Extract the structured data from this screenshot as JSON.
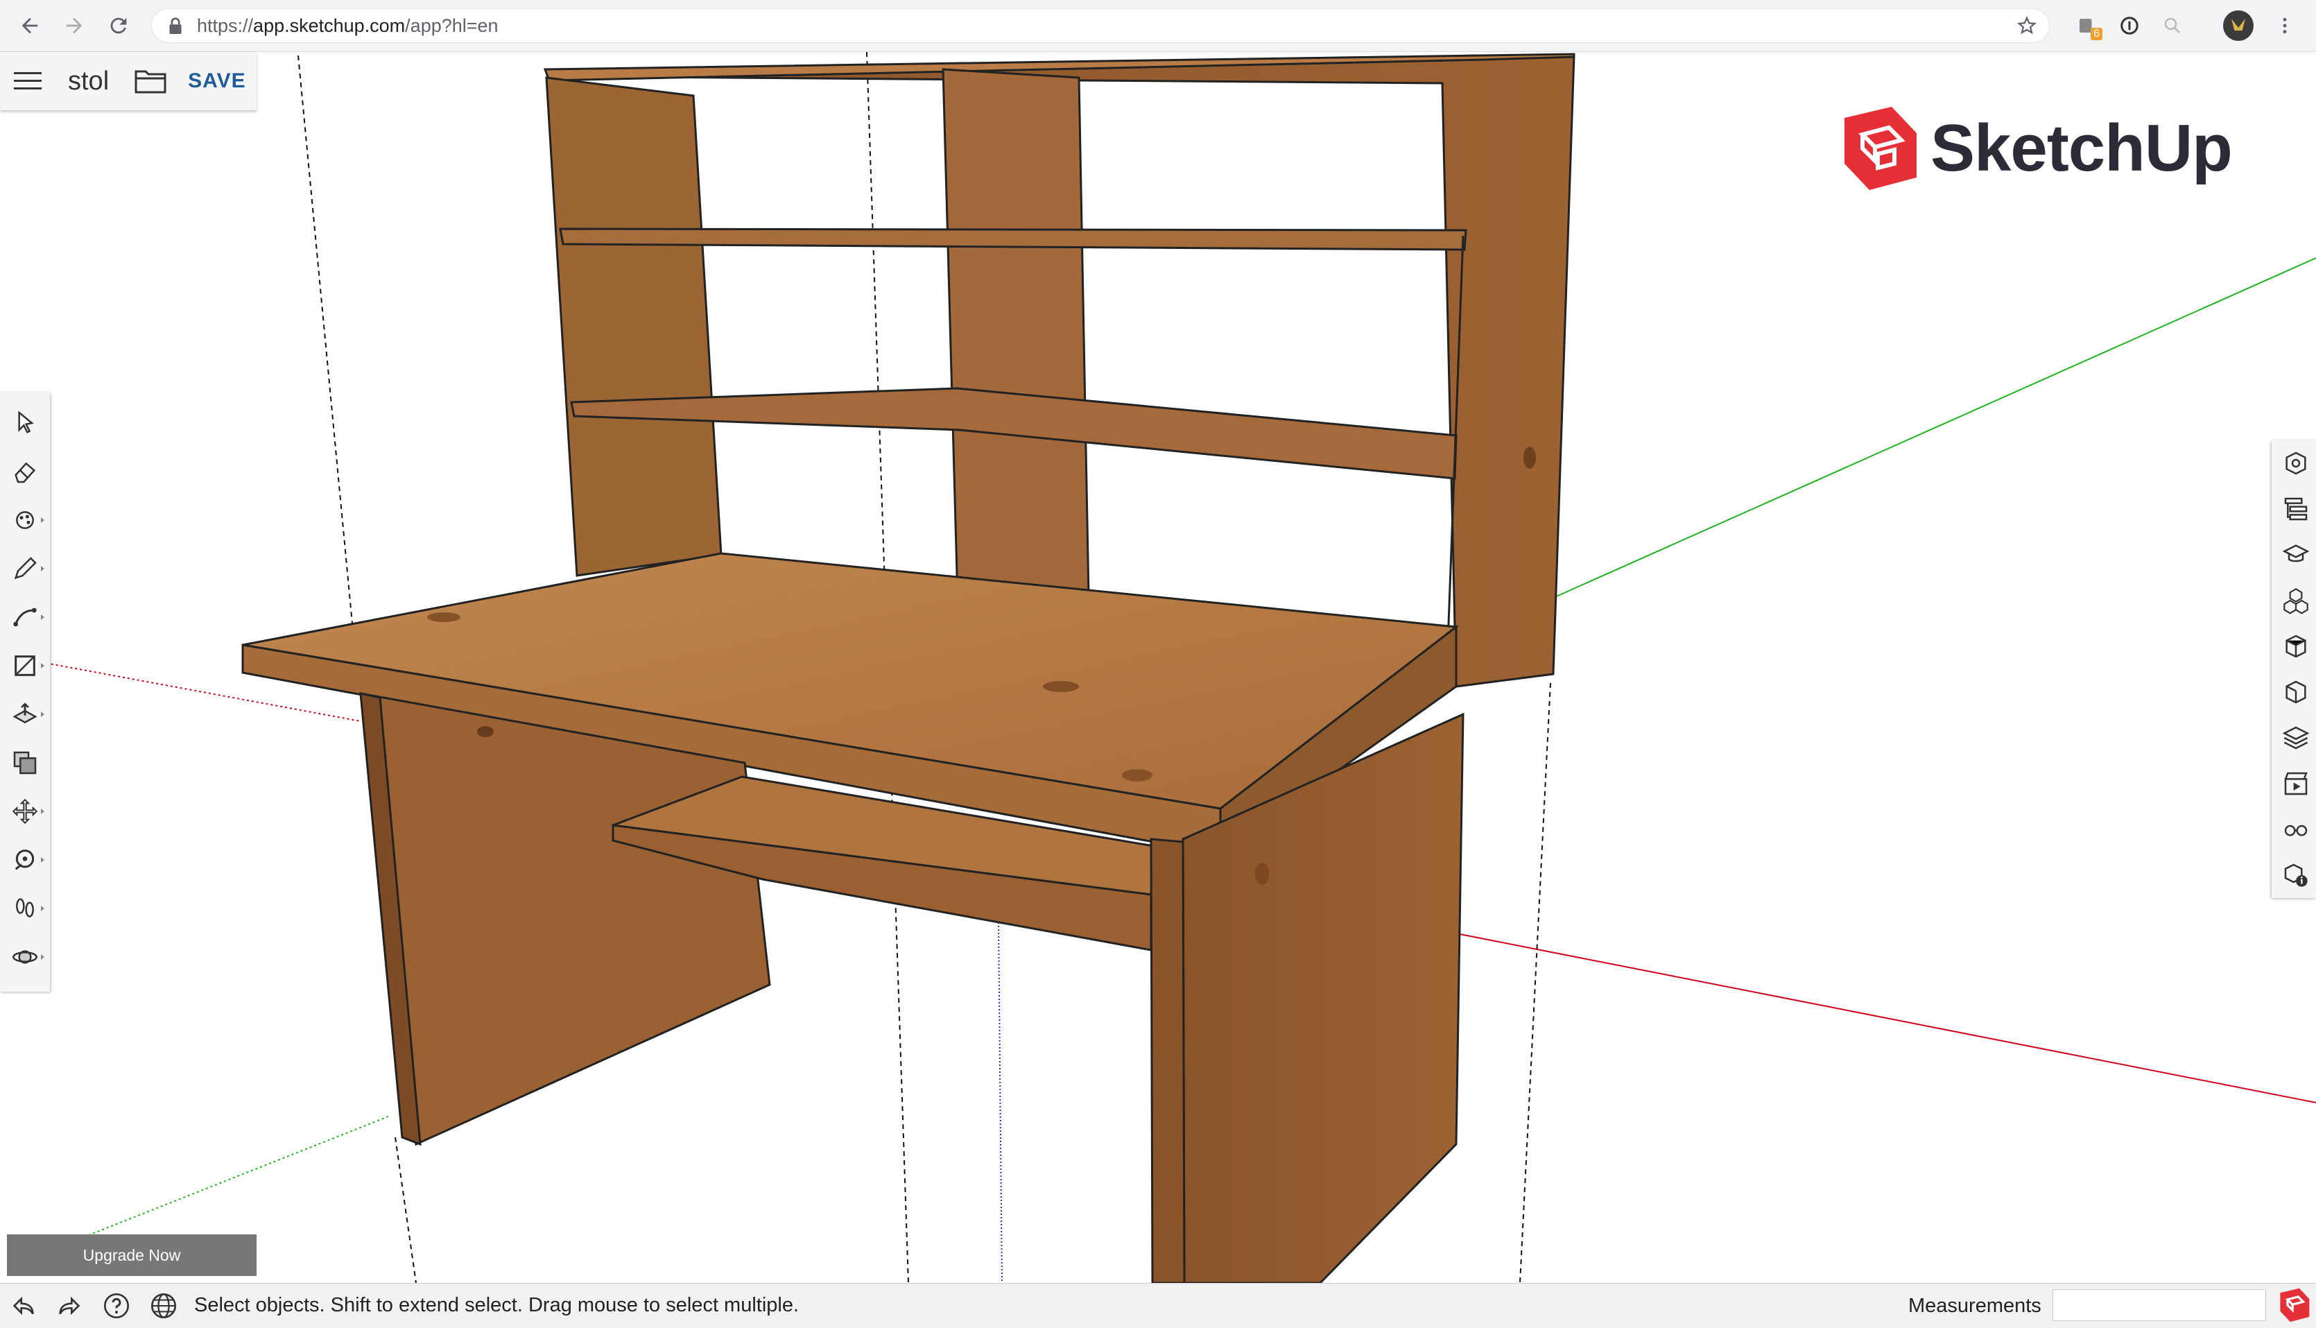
{
  "browser": {
    "url_prefix": "https://",
    "url_host": "app.sketchup.com",
    "url_path": "/app?hl=en",
    "extension_badge": "6"
  },
  "file_panel": {
    "model_name": "stol",
    "save_label": "SAVE"
  },
  "logo": {
    "text": "SketchUp",
    "brand_color": "#e62f36"
  },
  "left_toolbar": {
    "tools": [
      {
        "icon": "select-arrow-icon",
        "has_submenu": false
      },
      {
        "icon": "eraser-icon",
        "has_submenu": false
      },
      {
        "icon": "paint-bucket-icon",
        "has_submenu": true
      },
      {
        "icon": "pencil-line-icon",
        "has_submenu": true
      },
      {
        "icon": "arc-icon",
        "has_submenu": true
      },
      {
        "icon": "rectangle-icon",
        "has_submenu": true
      },
      {
        "icon": "push-pull-icon",
        "has_submenu": true
      },
      {
        "icon": "offset-icon",
        "has_submenu": false
      },
      {
        "icon": "move-icon",
        "has_submenu": true
      },
      {
        "icon": "tape-measure-icon",
        "has_submenu": true
      },
      {
        "icon": "walk-footprints-icon",
        "has_submenu": true
      },
      {
        "icon": "orbit-icon",
        "has_submenu": true
      }
    ]
  },
  "right_toolbar": {
    "panels": [
      "entity-info-icon",
      "outliner-icon",
      "instructor-icon",
      "components-icon",
      "materials-icon",
      "styles-icon",
      "layers-icon",
      "scenes-icon",
      "display-glasses-icon",
      "model-info-icon"
    ]
  },
  "upgrade": {
    "label": "Upgrade Now"
  },
  "status_bar": {
    "message": "Select objects. Shift to extend select. Drag mouse to select multiple.",
    "measurements_label": "Measurements",
    "measurements_value": ""
  },
  "colors": {
    "accent": "#1f5d99",
    "axis_red": "#d0021b",
    "axis_green": "#1fb41f",
    "axis_blue": "#2233cc",
    "wood_light": "#b8783f",
    "wood_dark": "#7a4a22"
  }
}
